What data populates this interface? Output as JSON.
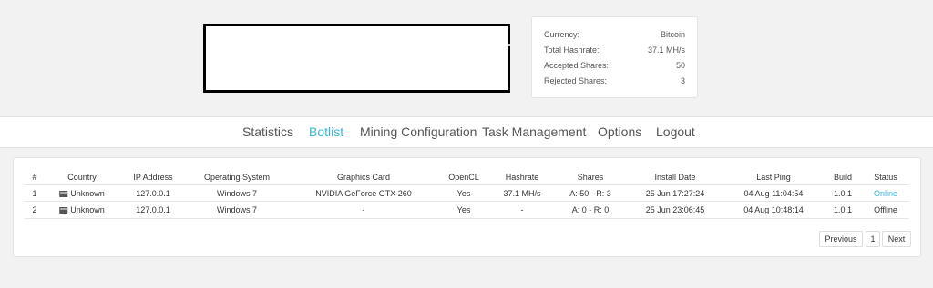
{
  "stats": {
    "rows": [
      {
        "label": "Currency:",
        "value": "Bitcoin"
      },
      {
        "label": "Total Hashrate:",
        "value": "37.1 MH/s"
      },
      {
        "label": "Accepted Shares:",
        "value": "50"
      },
      {
        "label": "Rejected Shares:",
        "value": "3"
      }
    ]
  },
  "nav": {
    "items": [
      {
        "label": "Statistics"
      },
      {
        "label": "Botlist"
      },
      {
        "label": "Mining Configuration"
      },
      {
        "label": "Task Management"
      },
      {
        "label": "Options"
      },
      {
        "label": "Logout"
      }
    ],
    "active_color": "#3bb4d6"
  },
  "table": {
    "headers": [
      "#",
      "Country",
      "IP Address",
      "Operating System",
      "Graphics Card",
      "OpenCL",
      "Hashrate",
      "Shares",
      "Install Date",
      "Last Ping",
      "Build",
      "Status"
    ],
    "rows": [
      {
        "num": "1",
        "country": "Unknown",
        "ip": "127.0.0.1",
        "os": "Windows 7",
        "gpu": "NVIDIA GeForce GTX 260",
        "opencl": "Yes",
        "hashrate": "37.1 MH/s",
        "shares": "A: 50 - R: 3",
        "install": "25 Jun 17:27:24",
        "ping": "04 Aug 11:04:54",
        "build": "1.0.1",
        "status": "Online"
      },
      {
        "num": "2",
        "country": "Unknown",
        "ip": "127.0.0.1",
        "os": "Windows 7",
        "gpu": "-",
        "opencl": "Yes",
        "hashrate": "-",
        "shares": "A: 0 - R: 0",
        "install": "25 Jun 23:06:45",
        "ping": "04 Aug 10:48:14",
        "build": "1.0.1",
        "status": "Offline"
      }
    ]
  },
  "pagination": {
    "previous": "Previous",
    "page": "1",
    "next": "Next"
  }
}
